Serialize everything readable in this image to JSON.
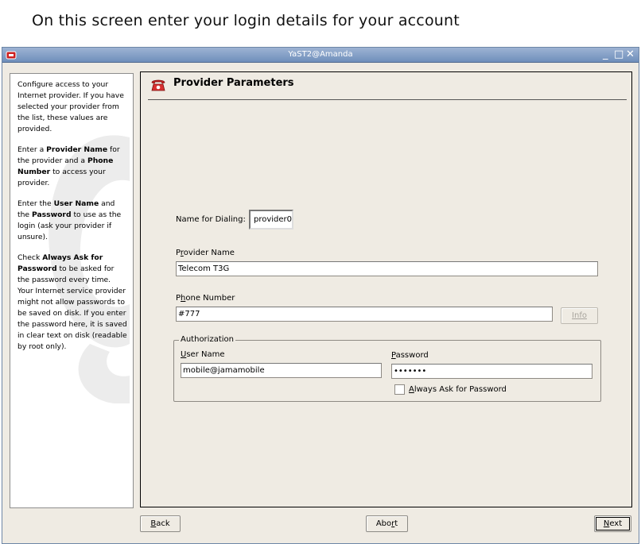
{
  "caption": "On this screen enter your login details for your account",
  "window": {
    "title": "YaST2@Amanda",
    "controls": {
      "minimize": "_",
      "maximize": "□",
      "close": "✕"
    }
  },
  "help": {
    "p1": "Configure access to your Internet provider. If you have selected your provider from the list, these values are provided.",
    "p2_pre": "Enter a ",
    "p2_b1": "Provider Name",
    "p2_mid": " for the provider and a ",
    "p2_b2": "Phone Number",
    "p2_post": " to access your provider.",
    "p3_pre": "Enter the ",
    "p3_b1": "User Name",
    "p3_mid": " and the ",
    "p3_b2": "Password",
    "p3_post": " to use as the login (ask your provider if unsure).",
    "p4_pre": "Check ",
    "p4_b1": "Always Ask for Password",
    "p4_post": " to be asked for the password every time. Your Internet service provider might not allow passwords to be saved on disk. If you enter the password here, it is saved in clear text on disk (readable by root only)."
  },
  "header": {
    "title": "Provider Parameters"
  },
  "form": {
    "dialing_label": "Name for Dialing:",
    "dialing_value": "provider0",
    "provider_label": "Provider Name",
    "provider_label_mnemonic": "r",
    "provider_value": "Telecom T3G",
    "phone_label": "Phone Number",
    "phone_label_mnemonic": "h",
    "phone_value": "#777",
    "info_label": "Info",
    "auth_legend": "Authorization",
    "user_label": "User Name",
    "user_label_mnemonic": "U",
    "user_value": "mobile@jamamobile",
    "password_label": "Password",
    "password_label_mnemonic": "P",
    "password_value": "•••••••",
    "always_ask_label": "Always Ask for Password",
    "always_ask_mnemonic": "A",
    "always_ask_checked": false
  },
  "buttons": {
    "back": "Back",
    "back_mnemonic": "B",
    "abort": "Abort",
    "abort_mnemonic": "r",
    "next": "Next",
    "next_mnemonic": "N"
  },
  "colors": {
    "accent": "#cc2020",
    "titlebar": "#7f9cc4",
    "dialog_bg": "#efebe3"
  }
}
